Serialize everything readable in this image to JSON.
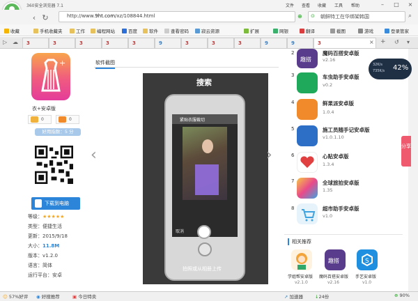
{
  "browser": {
    "title": "360安全浏览器 7.1",
    "menu": [
      "文件",
      "查看",
      "收藏",
      "工具",
      "帮助"
    ],
    "url_prefix": "http://www.",
    "url_host": "9ht.com",
    "url_path": "/xz/108844.html",
    "search_placeholder": "朝鲜特工在华绑架韩国",
    "bookmarks": [
      "收藏",
      "手机收藏夹",
      "工作",
      "编程网站",
      "百度",
      "软件",
      "查看密码",
      "寂云资源",
      "扩展",
      "网银",
      "翻译",
      "截图",
      "游戏",
      "登录管家"
    ],
    "tabs": [
      "3",
      "3",
      "3",
      "3",
      "3",
      "9",
      "3",
      "3",
      "3",
      "9",
      "9",
      "3"
    ]
  },
  "app": {
    "name": "衣+安卓版",
    "vote_up": "0",
    "vote_down": "0",
    "rating": "好用指数：5 分",
    "download_label": "下载到电脑",
    "info": [
      {
        "label": "等级：",
        "value": "★★★★★"
      },
      {
        "label": "类型：",
        "value": "便捷生活"
      },
      {
        "label": "更新：",
        "value": "2015/9/18"
      },
      {
        "label": "大小：",
        "value": "11.8M"
      },
      {
        "label": "版本：",
        "value": "v1.2.0"
      },
      {
        "label": "语言：",
        "value": "简体"
      },
      {
        "label": "运行平台：",
        "value": "安卓"
      }
    ]
  },
  "screenshot": {
    "section_title": "软件截图",
    "title": "搜索",
    "header": "紧贴衣服裁切",
    "cancel": "取消",
    "caption": "拍照或从相册上传"
  },
  "ranking": [
    {
      "num": "2",
      "name": "魔码百搭安卓版",
      "version": "v2.16",
      "color": "#5a3c8c"
    },
    {
      "num": "3",
      "name": "车虫助手安卓版",
      "version": "v0.2",
      "color": "#1fa95a"
    },
    {
      "num": "4",
      "name": "鲜果派安卓版",
      "version": "1.0.4",
      "color": "#f08a2a"
    },
    {
      "num": "5",
      "name": "施工员随手记安卓版",
      "version": "v1.0.1.10",
      "color": "#2d6fc7"
    },
    {
      "num": "6",
      "name": "心贴安卓版",
      "version": "1.3.4",
      "color": "#e04040"
    },
    {
      "num": "7",
      "name": "全球旅拍安卓版",
      "version": "1.35",
      "color": "#e94a8a"
    },
    {
      "num": "8",
      "name": "超市助手安卓版",
      "version": "v1.0",
      "color": "#3fa3e0"
    }
  ],
  "related": {
    "title": "相关推荐",
    "apps": [
      {
        "name": "学姐帮安卓版",
        "version": "v2.1.0",
        "color": "#f3a53c"
      },
      {
        "name": "魔码百搭安卓版",
        "version": "v2.16",
        "color": "#5a3c8c"
      },
      {
        "name": "手艺安卓版",
        "version": "v1.0",
        "color": "#1f8fe0"
      }
    ]
  },
  "widget": {
    "up": "32K/s",
    "down": "735K/s",
    "percent": "42%",
    "share": "分享"
  },
  "statusbar": [
    "57%好评",
    "好搜推荐",
    "今日特卖",
    "加速器",
    "24份",
    "90%"
  ]
}
